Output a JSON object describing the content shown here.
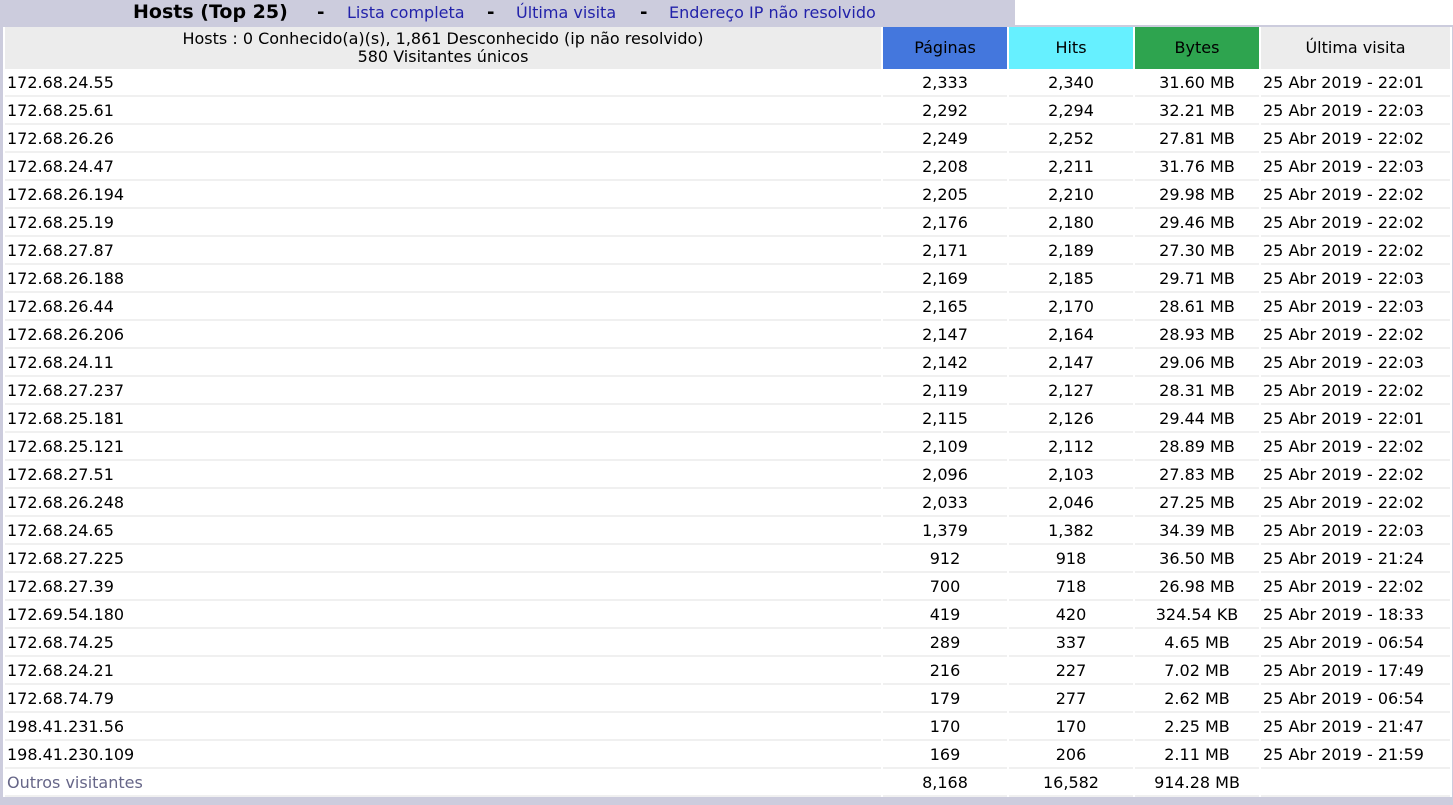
{
  "title_bar": {
    "title": "Hosts (Top 25)",
    "separator": "-",
    "links": [
      "Lista completa",
      "Última visita",
      "Endereço IP não resolvido"
    ]
  },
  "table": {
    "summary_line1": "Hosts : 0 Conhecido(a)(s), 1,861 Desconhecido (ip não resolvido)",
    "summary_line2": "580 Visitantes únicos",
    "columns": [
      "Páginas",
      "Hits",
      "Bytes",
      "Última visita"
    ],
    "column_colors": {
      "pages": "#4477dd",
      "hits": "#66f0ff",
      "bytes": "#2ea44f"
    },
    "rows": [
      {
        "host": "172.68.24.55",
        "pages": "2,333",
        "hits": "2,340",
        "bytes": "31.60 MB",
        "last": "25 Abr 2019 - 22:01"
      },
      {
        "host": "172.68.25.61",
        "pages": "2,292",
        "hits": "2,294",
        "bytes": "32.21 MB",
        "last": "25 Abr 2019 - 22:03"
      },
      {
        "host": "172.68.26.26",
        "pages": "2,249",
        "hits": "2,252",
        "bytes": "27.81 MB",
        "last": "25 Abr 2019 - 22:02"
      },
      {
        "host": "172.68.24.47",
        "pages": "2,208",
        "hits": "2,211",
        "bytes": "31.76 MB",
        "last": "25 Abr 2019 - 22:03"
      },
      {
        "host": "172.68.26.194",
        "pages": "2,205",
        "hits": "2,210",
        "bytes": "29.98 MB",
        "last": "25 Abr 2019 - 22:02"
      },
      {
        "host": "172.68.25.19",
        "pages": "2,176",
        "hits": "2,180",
        "bytes": "29.46 MB",
        "last": "25 Abr 2019 - 22:02"
      },
      {
        "host": "172.68.27.87",
        "pages": "2,171",
        "hits": "2,189",
        "bytes": "27.30 MB",
        "last": "25 Abr 2019 - 22:02"
      },
      {
        "host": "172.68.26.188",
        "pages": "2,169",
        "hits": "2,185",
        "bytes": "29.71 MB",
        "last": "25 Abr 2019 - 22:03"
      },
      {
        "host": "172.68.26.44",
        "pages": "2,165",
        "hits": "2,170",
        "bytes": "28.61 MB",
        "last": "25 Abr 2019 - 22:03"
      },
      {
        "host": "172.68.26.206",
        "pages": "2,147",
        "hits": "2,164",
        "bytes": "28.93 MB",
        "last": "25 Abr 2019 - 22:02"
      },
      {
        "host": "172.68.24.11",
        "pages": "2,142",
        "hits": "2,147",
        "bytes": "29.06 MB",
        "last": "25 Abr 2019 - 22:03"
      },
      {
        "host": "172.68.27.237",
        "pages": "2,119",
        "hits": "2,127",
        "bytes": "28.31 MB",
        "last": "25 Abr 2019 - 22:02"
      },
      {
        "host": "172.68.25.181",
        "pages": "2,115",
        "hits": "2,126",
        "bytes": "29.44 MB",
        "last": "25 Abr 2019 - 22:01"
      },
      {
        "host": "172.68.25.121",
        "pages": "2,109",
        "hits": "2,112",
        "bytes": "28.89 MB",
        "last": "25 Abr 2019 - 22:02"
      },
      {
        "host": "172.68.27.51",
        "pages": "2,096",
        "hits": "2,103",
        "bytes": "27.83 MB",
        "last": "25 Abr 2019 - 22:02"
      },
      {
        "host": "172.68.26.248",
        "pages": "2,033",
        "hits": "2,046",
        "bytes": "27.25 MB",
        "last": "25 Abr 2019 - 22:02"
      },
      {
        "host": "172.68.24.65",
        "pages": "1,379",
        "hits": "1,382",
        "bytes": "34.39 MB",
        "last": "25 Abr 2019 - 22:03"
      },
      {
        "host": "172.68.27.225",
        "pages": "912",
        "hits": "918",
        "bytes": "36.50 MB",
        "last": "25 Abr 2019 - 21:24"
      },
      {
        "host": "172.68.27.39",
        "pages": "700",
        "hits": "718",
        "bytes": "26.98 MB",
        "last": "25 Abr 2019 - 22:02"
      },
      {
        "host": "172.69.54.180",
        "pages": "419",
        "hits": "420",
        "bytes": "324.54 KB",
        "last": "25 Abr 2019 - 18:33"
      },
      {
        "host": "172.68.74.25",
        "pages": "289",
        "hits": "337",
        "bytes": "4.65 MB",
        "last": "25 Abr 2019 - 06:54"
      },
      {
        "host": "172.68.24.21",
        "pages": "216",
        "hits": "227",
        "bytes": "7.02 MB",
        "last": "25 Abr 2019 - 17:49"
      },
      {
        "host": "172.68.74.79",
        "pages": "179",
        "hits": "277",
        "bytes": "2.62 MB",
        "last": "25 Abr 2019 - 06:54"
      },
      {
        "host": "198.41.231.56",
        "pages": "170",
        "hits": "170",
        "bytes": "2.25 MB",
        "last": "25 Abr 2019 - 21:47"
      },
      {
        "host": "198.41.230.109",
        "pages": "169",
        "hits": "206",
        "bytes": "2.11 MB",
        "last": "25 Abr 2019 - 21:59"
      }
    ],
    "others": {
      "host": "Outros visitantes",
      "pages": "8,168",
      "hits": "16,582",
      "bytes": "914.28 MB",
      "last": ""
    }
  }
}
